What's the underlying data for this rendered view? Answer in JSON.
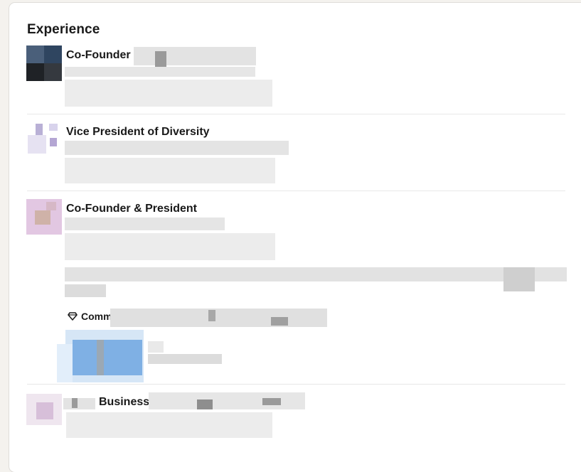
{
  "section": {
    "heading": "Experience"
  },
  "entries": [
    {
      "title": "Co-Founder"
    },
    {
      "title": "Vice President of Diversity"
    },
    {
      "title": "Co-Founder & President",
      "skills_label": "Comm"
    },
    {
      "title": "Business"
    }
  ],
  "icons": {
    "skills": "diamond-icon"
  },
  "colors": {
    "background": "#f4f2ee",
    "card": "#ffffff",
    "divider": "#e8e8e8",
    "text": "#1f1f1f"
  }
}
